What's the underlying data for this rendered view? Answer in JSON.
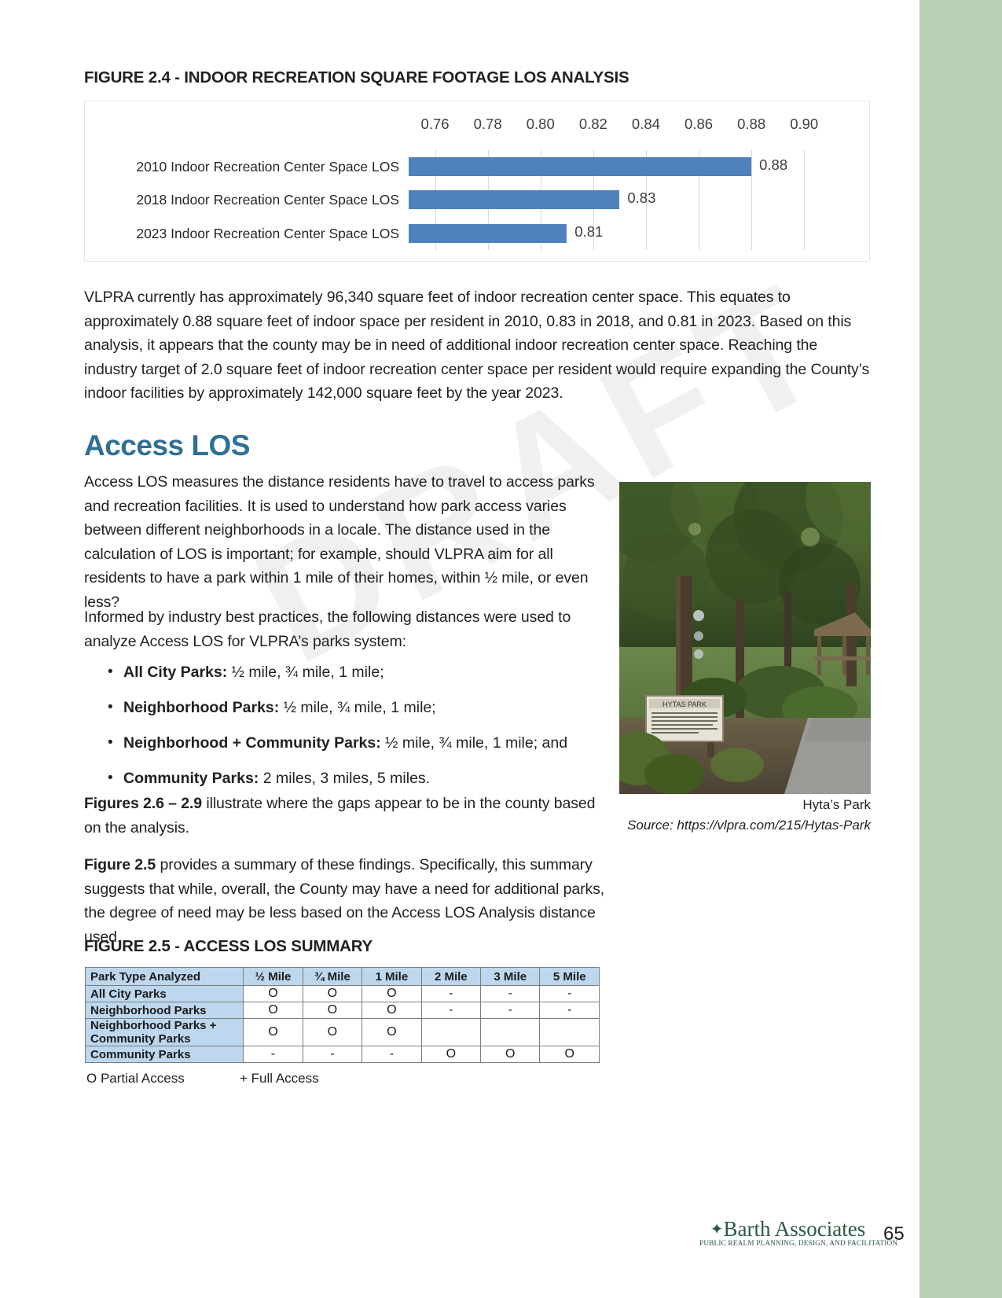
{
  "figure_24": {
    "title": "FIGURE 2.4 - INDOOR RECREATION SQUARE FOOTAGE LOS ANALYSIS"
  },
  "chart_data": {
    "type": "bar",
    "orientation": "horizontal",
    "title": "FIGURE 2.4 - INDOOR RECREATION SQUARE FOOTAGE LOS ANALYSIS",
    "categories": [
      "2010 Indoor Recreation Center Space LOS",
      "2018 Indoor Recreation Center Space LOS",
      "2023 Indoor Recreation Center Space LOS"
    ],
    "values": [
      0.88,
      0.83,
      0.81
    ],
    "data_labels": [
      "0.88",
      "0.83",
      "0.81"
    ],
    "tick_labels": [
      "0.76",
      "0.78",
      "0.80",
      "0.82",
      "0.84",
      "0.86",
      "0.88",
      "0.90"
    ],
    "tick_values": [
      0.76,
      0.78,
      0.8,
      0.82,
      0.84,
      0.86,
      0.88,
      0.9
    ],
    "xlim": [
      0.75,
      0.905
    ],
    "xlabel": "",
    "ylabel": "",
    "grid": true,
    "legend": "none",
    "bar_color": "#4f81bd",
    "axis_position": "top"
  },
  "body": {
    "para1_a": "VLPRA currently has approximately 96,340 square feet of indoor recreation center space. This equates to approximately 0.88 square feet of indoor space per resident in 2010, 0.83 in 2018, and 0.81 in 2023. Based on this analysis, it appears that the county may be in need of additional indoor recreation center space. Reaching the industry target of 2.0 square feet of indoor recreation center space per resident would require expanding the County’s indoor facilities by approximately 142,000 square feet by the year 2023.",
    "section_heading": "Access LOS",
    "para2": "Access LOS measures the distance residents have to travel to access parks and recreation facilities. It is used to understand how park access varies between different neighborhoods in a locale. The distance used in the calculation of LOS is important; for example, should VLPRA aim for all residents to have a park within 1 mile of their homes, within ½ mile, or even less?",
    "para3": "Informed by industry best practices, the following distances were used to analyze Access LOS for VLPRA’s parks system:",
    "bullets": [
      {
        "label": "All City Parks:",
        "text": " ½ mile, ¾ mile, 1 mile;"
      },
      {
        "label": "Neighborhood Parks:",
        "text": " ½ mile, ¾ mile, 1 mile;"
      },
      {
        "label": "Neighborhood + Community Parks:",
        "text": " ½ mile, ¾ mile, 1 mile; and"
      },
      {
        "label": "Community Parks:",
        "text": " 2 miles, 3 miles, 5 miles."
      }
    ],
    "para4_bold": "Figures 2.6 – 2.9",
    "para4_rest": " illustrate where the gaps appear to be in the county based on the analysis.",
    "para5_bold": "Figure 2.5",
    "para5_rest": " provides a summary of these findings. Specifically, this summary suggests that while, overall, the County may have a need for additional parks, the degree of need may be less based on the Access LOS Analysis distance used."
  },
  "photo": {
    "caption": "Hyta’s Park",
    "source": "Source: https://vlpra.com/215/Hytas-Park"
  },
  "figure_25": {
    "title": "FIGURE 2.5 - ACCESS LOS SUMMARY",
    "table": {
      "type": "table",
      "headers": [
        "Park Type Analyzed",
        "½ Mile",
        "¾ Mile",
        "1 Mile",
        "2 Mile",
        "3 Mile",
        "5 Mile"
      ],
      "rows": [
        {
          "label": "All City Parks",
          "cells": [
            "O",
            "O",
            "O",
            "-",
            "-",
            "-"
          ]
        },
        {
          "label": "Neighborhood Parks",
          "cells": [
            "O",
            "O",
            "O",
            "-",
            "-",
            "-"
          ]
        },
        {
          "label": "Neighborhood Parks + Community Parks",
          "cells": [
            "O",
            "O",
            "O",
            "",
            "",
            ""
          ]
        },
        {
          "label": "Community Parks",
          "cells": [
            "-",
            "-",
            "-",
            "O",
            "O",
            "O"
          ]
        }
      ],
      "header_bg": "#bdd7ee"
    },
    "legend_partial": "O Partial Access",
    "legend_full": "+ Full Access"
  },
  "footer": {
    "brand": "Barth Associates",
    "tagline": "PUBLIC REALM PLANNING, DESIGN, AND FACILITATION",
    "page_number": "65",
    "brand_color": "#2c5840"
  },
  "watermark": "DRAFT",
  "theme": {
    "accent_blue": "#2e6f96",
    "bar_blue": "#4f81bd",
    "edge_green": "#b9cfb4",
    "table_header_blue": "#bdd7ee"
  }
}
